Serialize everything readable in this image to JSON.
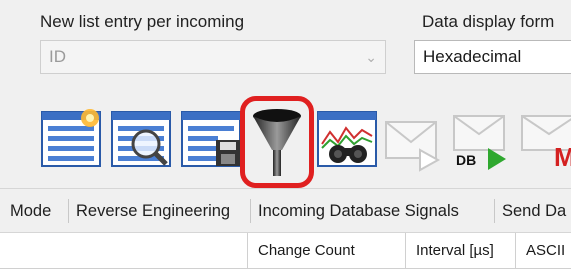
{
  "options": {
    "list_entry_label": "New list entry per incoming",
    "list_entry_value": "ID",
    "display_format_label": "Data display form",
    "display_format_value": "Hexadecimal"
  },
  "toolbar": {
    "db_label": "DB",
    "partial_letter": "M",
    "buttons": [
      {
        "icon": "list-star-icon"
      },
      {
        "icon": "list-search-icon"
      },
      {
        "icon": "list-save-icon"
      },
      {
        "icon": "filter-funnel-icon",
        "highlighted": true
      },
      {
        "icon": "chart-binoculars-icon"
      },
      {
        "icon": "send-message-icon"
      },
      {
        "icon": "send-db-message-icon"
      },
      {
        "icon": "send-message-m-icon"
      }
    ]
  },
  "tabs": [
    "Mode",
    "Reverse Engineering",
    "Incoming Database Signals",
    "Send Da"
  ],
  "table": {
    "columns": [
      "",
      "Change Count",
      "Interval [µs]",
      "ASCII"
    ]
  },
  "colors": {
    "highlight": "#e02020",
    "play_green": "#2fa82f",
    "letter_red": "#d42020"
  }
}
